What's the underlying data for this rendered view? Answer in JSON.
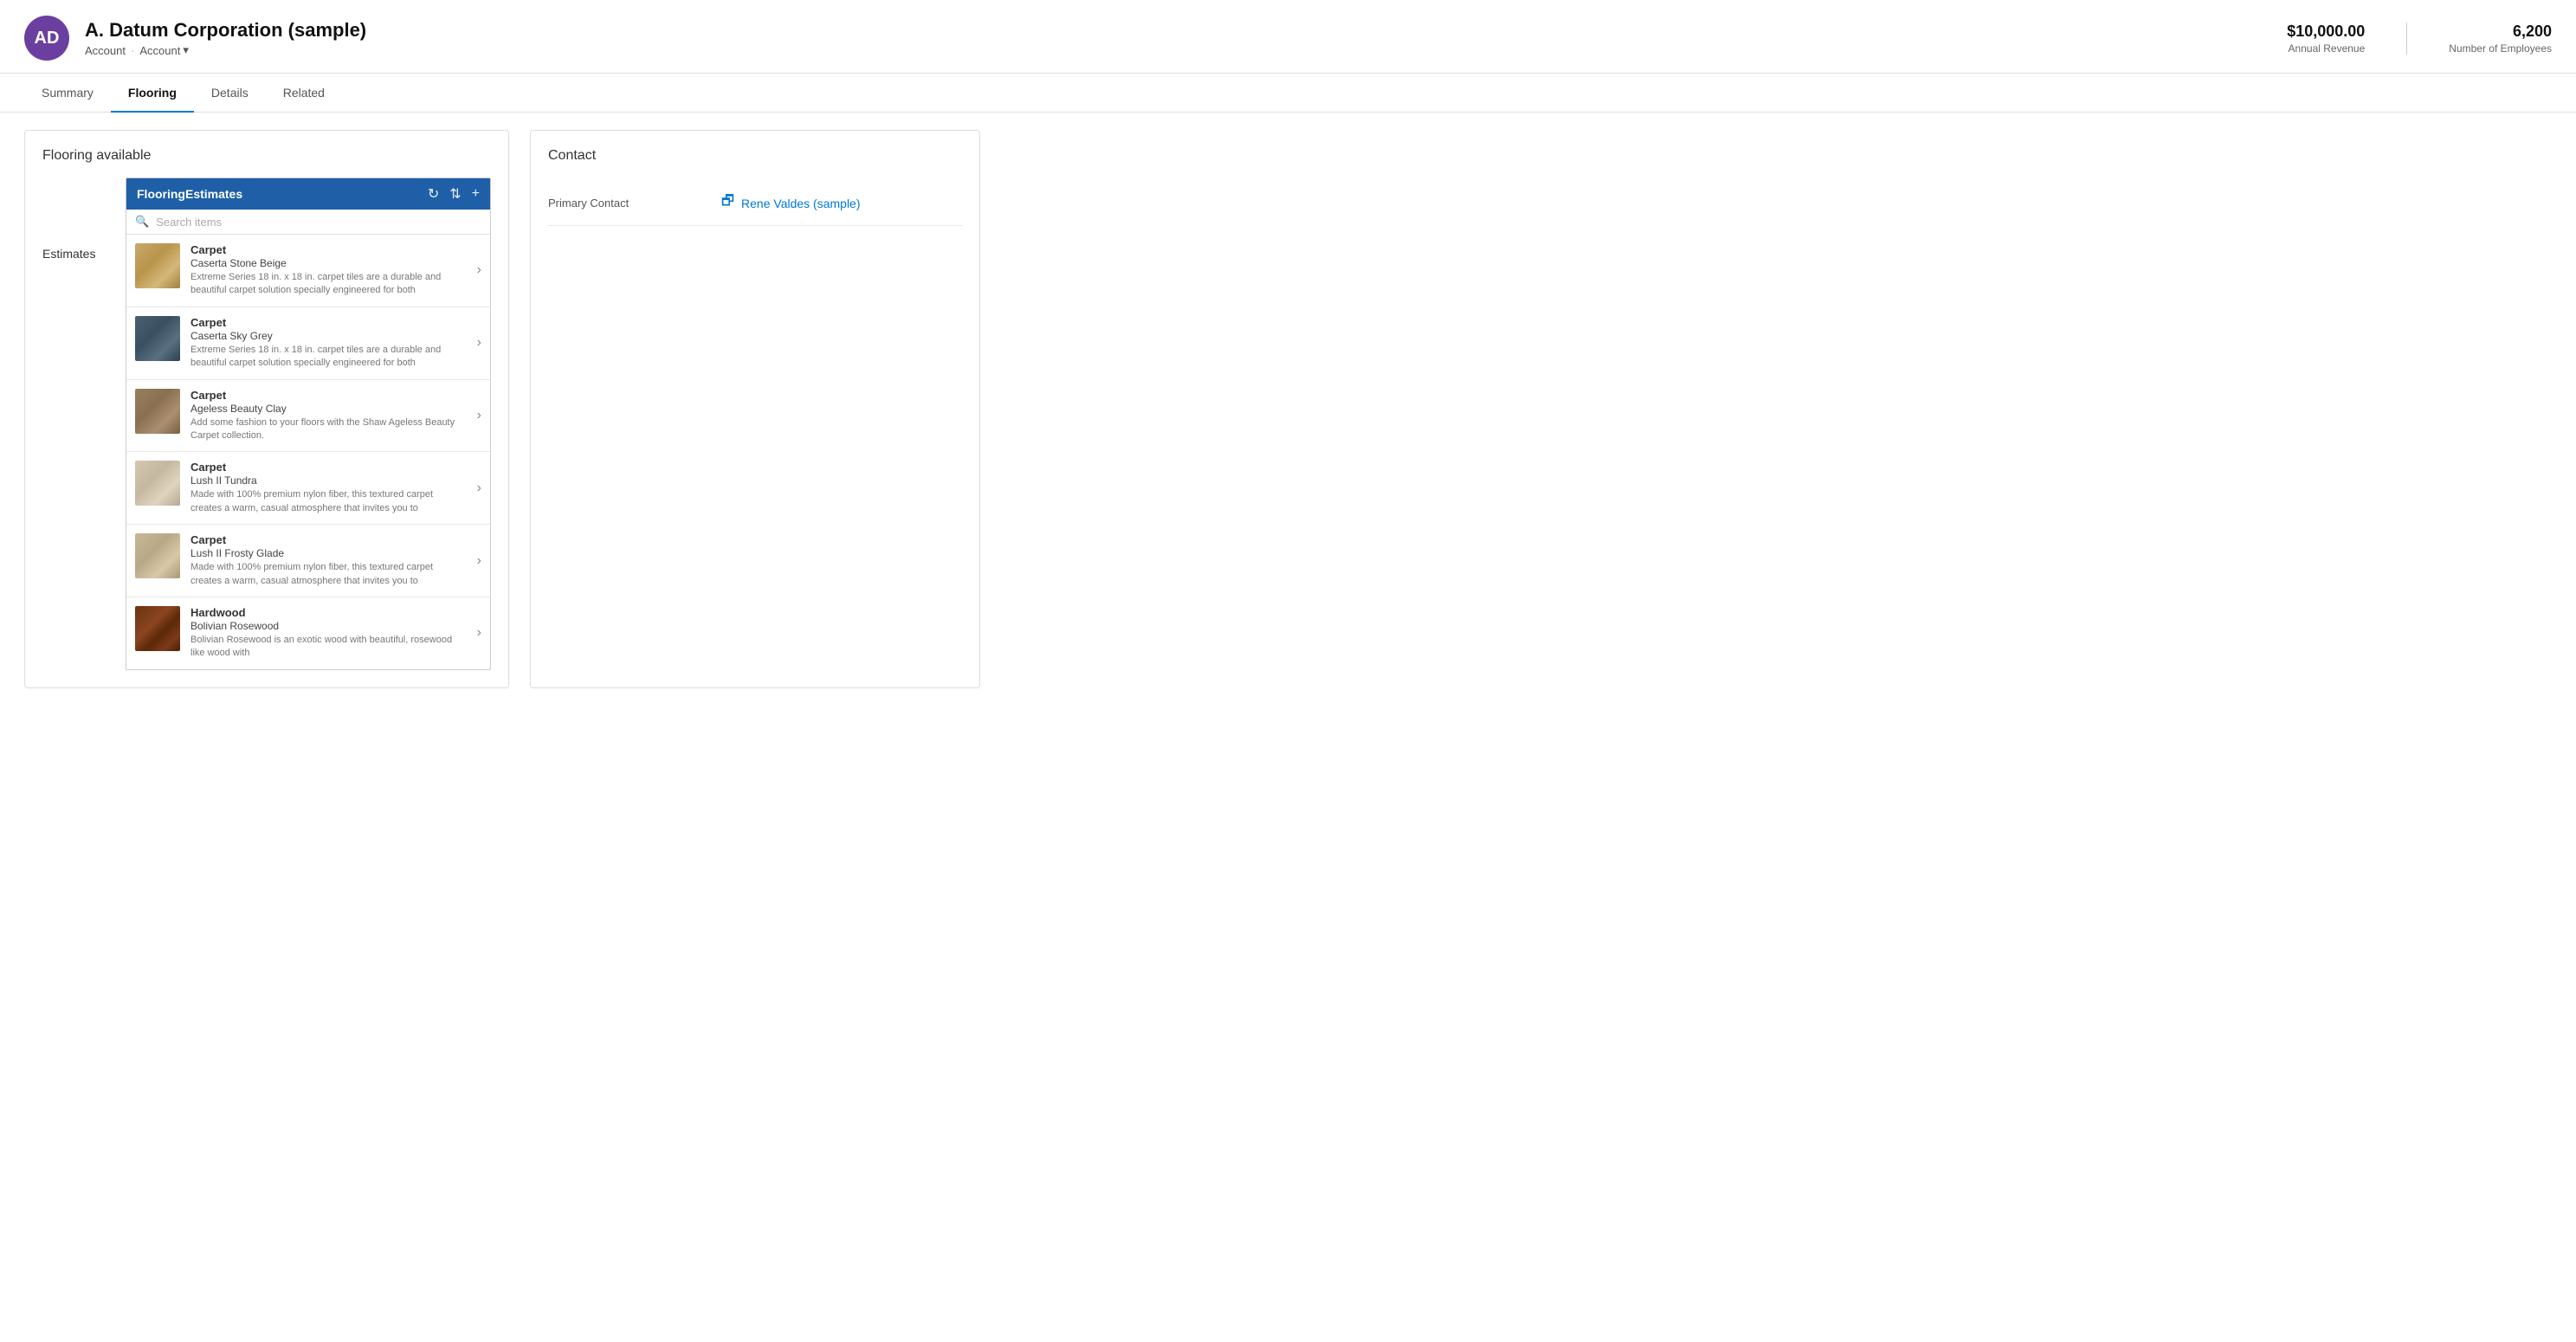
{
  "header": {
    "avatar_initials": "AD",
    "company_name": "A. Datum Corporation (sample)",
    "breadcrumb1": "Account",
    "breadcrumb_dot": "·",
    "breadcrumb2": "Account",
    "annual_revenue_label": "Annual Revenue",
    "annual_revenue_value": "$10,000.00",
    "employees_label": "Number of Employees",
    "employees_value": "6,200"
  },
  "tabs": [
    {
      "id": "summary",
      "label": "Summary",
      "active": false
    },
    {
      "id": "flooring",
      "label": "Flooring",
      "active": true
    },
    {
      "id": "details",
      "label": "Details",
      "active": false
    },
    {
      "id": "related",
      "label": "Related",
      "active": false
    }
  ],
  "left_panel": {
    "title": "Flooring available",
    "estimates_label": "Estimates",
    "list_header": "FlooringEstimates",
    "search_placeholder": "Search items",
    "items": [
      {
        "category": "Carpet",
        "name": "Caserta Stone Beige",
        "description": "Extreme Series 18 in. x 18 in. carpet tiles are a durable and beautiful carpet solution specially engineered for both",
        "thumb_class": "thumb-carpet-beige"
      },
      {
        "category": "Carpet",
        "name": "Caserta Sky Grey",
        "description": "Extreme Series 18 in. x 18 in. carpet tiles are a durable and beautiful carpet solution specially engineered for both",
        "thumb_class": "thumb-carpet-grey"
      },
      {
        "category": "Carpet",
        "name": "Ageless Beauty Clay",
        "description": "Add some fashion to your floors with the Shaw Ageless Beauty Carpet collection.",
        "thumb_class": "thumb-carpet-clay"
      },
      {
        "category": "Carpet",
        "name": "Lush II Tundra",
        "description": "Made with 100% premium nylon fiber, this textured carpet creates a warm, casual atmosphere that invites you to",
        "thumb_class": "thumb-carpet-tundra"
      },
      {
        "category": "Carpet",
        "name": "Lush II Frosty Glade",
        "description": "Made with 100% premium nylon fiber, this textured carpet creates a warm, casual atmosphere that invites you to",
        "thumb_class": "thumb-carpet-frosty"
      },
      {
        "category": "Hardwood",
        "name": "Bolivian Rosewood",
        "description": "Bolivian Rosewood is an exotic wood with beautiful, rosewood like wood with",
        "thumb_class": "thumb-hardwood"
      }
    ]
  },
  "right_panel": {
    "title": "Contact",
    "primary_contact_label": "Primary Contact",
    "primary_contact_name": "Rene Valdes (sample)"
  }
}
